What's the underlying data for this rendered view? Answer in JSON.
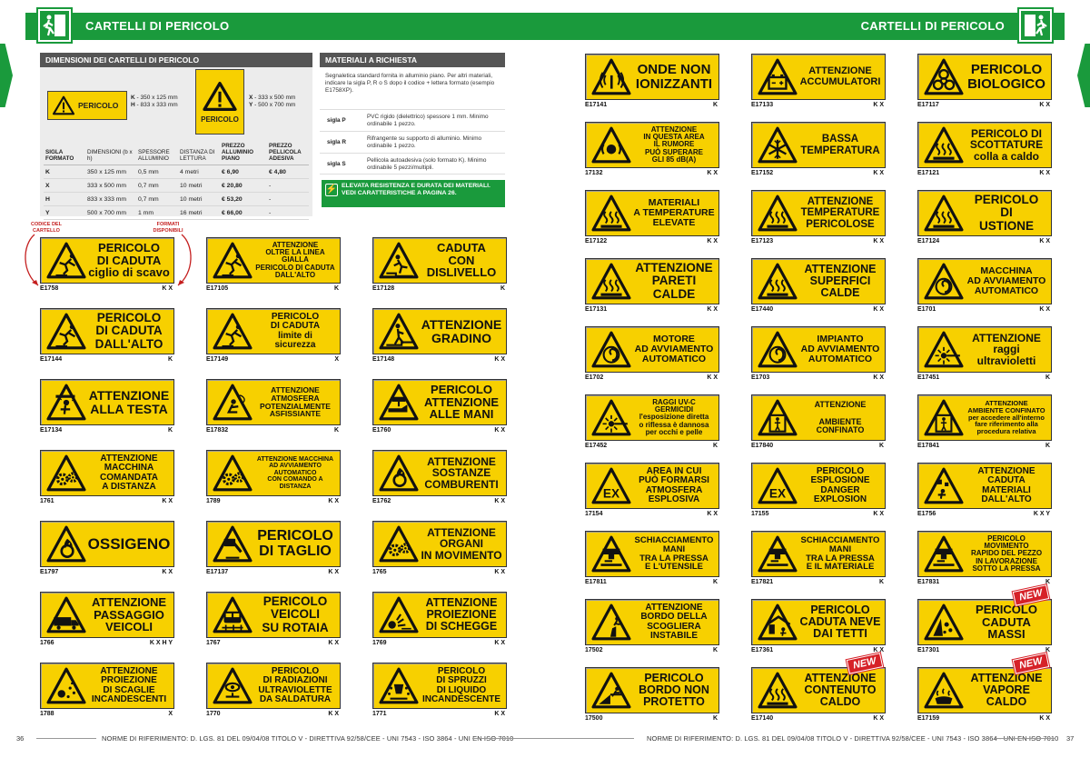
{
  "header": {
    "left_title": "CARTELLI DI PERICOLO",
    "right_title": "CARTELLI DI PERICOLO"
  },
  "dimensions_panel": {
    "title": "DIMENSIONI DEI CARTELLI DI PERICOLO",
    "sample_k_text": "PERICOLO",
    "sample_x_text": "PERICOLO",
    "k_label": "K",
    "k_value": " - 350 x 125 mm",
    "h_label": "H",
    "h_value": " - 833 x 333 mm",
    "x_label": "X",
    "x_value": " - 333 x 500 mm",
    "y_label": "Y",
    "y_value": " - 500 x 700 mm",
    "columns": [
      "SIGLA FORMATO",
      "DIMENSIONI (b x h)",
      "SPESSORE ALLUMINIO",
      "DISTANZA DI LETTURA",
      "PREZZO ALLUMINIO PIANO",
      "PREZZO PELLICOLA ADESIVA"
    ],
    "rows": [
      [
        "K",
        "350 x 125 mm",
        "0,5 mm",
        "4 metri",
        "€ 6,90",
        "€ 4,80"
      ],
      [
        "X",
        "333 x 500 mm",
        "0,7 mm",
        "10 metri",
        "€ 20,80",
        "-"
      ],
      [
        "H",
        "833 x 333 mm",
        "0,7 mm",
        "10 metri",
        "€ 53,20",
        "-"
      ],
      [
        "Y",
        "500 x 700 mm",
        "1 mm",
        "16 metri",
        "€ 66,00",
        "-"
      ]
    ]
  },
  "materials_panel": {
    "title": "MATERIALI A RICHIESTA",
    "description": "Segnaletica standard fornita in alluminio piano. Per altri materiali, indicare la sigla P, R o S dopo il codice + lettera formato (esempio E1758XP).",
    "items": [
      {
        "key": "sigla P",
        "value": "PVC rigido (dielettrico) spessore 1 mm. Minimo ordinabile 1 pezzo."
      },
      {
        "key": "sigla R",
        "value": "Rifrangente su supporto di alluminio. Minimo ordinabile 1 pezzo."
      },
      {
        "key": "sigla S",
        "value": "Pellicola autoadesiva (solo formato K). Minimo ordinabile 5 pezzi/multipli."
      }
    ],
    "note": "ELEVATA RESISTENZA E DURATA DEI MATERIALI. VEDI CARATTERISTICHE A PAGINA 26."
  },
  "annotations": {
    "code_label": "CODICE DEL CARTELLO",
    "formats_label": "FORMATI DISPONIBILI"
  },
  "signs": [
    {
      "code": "E1758",
      "formats": "K X",
      "text": "PERICOLO\nDI CADUTA\nciglio di scavo",
      "icon": "falling-person-icon",
      "size": 13,
      "new": false
    },
    {
      "code": "E17105",
      "formats": "K",
      "text": "ATTENZIONE\nOLTRE LA LINEA GIALLA\nPERICOLO DI CADUTA\nDALL'ALTO",
      "icon": "falling-person-icon",
      "size": 8,
      "new": false
    },
    {
      "code": "E17128",
      "formats": "K",
      "text": "CADUTA\nCON\nDISLIVELLO",
      "icon": "step-fall-icon",
      "size": 13,
      "new": false
    },
    {
      "code": "E17144",
      "formats": "K",
      "text": "PERICOLO\nDI CADUTA\nDALL'ALTO",
      "icon": "falling-person-icon",
      "size": 14,
      "new": false
    },
    {
      "code": "E17149",
      "formats": "X",
      "text": "PERICOLO\nDI CADUTA\nlimite di\nsicurezza",
      "icon": "falling-person-icon",
      "size": 12,
      "new": false
    },
    {
      "code": "E17148",
      "formats": "K X",
      "text": "ATTENZIONE\nGRADINO",
      "icon": "step-icon",
      "size": 15,
      "new": false
    },
    {
      "code": "E17134",
      "formats": "K",
      "text": "ATTENZIONE\nALLA TESTA",
      "icon": "head-bump-icon",
      "size": 15,
      "new": false
    },
    {
      "code": "E17832",
      "formats": "K",
      "text": "ATTENZIONE\nATMOSFERA POTENZIALMENTE\nASFISSIANTE",
      "icon": "asphyxia-icon",
      "size": 8.5,
      "new": false
    },
    {
      "code": "E1760",
      "formats": "K X",
      "text": "PERICOLO\nATTENZIONE\nALLE MANI",
      "icon": "hand-crush-icon",
      "size": 13,
      "new": false
    },
    {
      "code": "1761",
      "formats": "K X",
      "text": "ATTENZIONE\nMACCHINA\nCOMANDATA\nA DISTANZA",
      "icon": "gears-icon",
      "size": 11,
      "new": false
    },
    {
      "code": "1789",
      "formats": "K X",
      "text": "ATTENZIONE MACCHINA\nAD AVVIAMENTO AUTOMATICO\nCON COMANDO A DISTANZA",
      "icon": "gears-icon",
      "size": 8,
      "new": false
    },
    {
      "code": "E1762",
      "formats": "K X",
      "text": "ATTENZIONE\nSOSTANZE\nCOMBURENTI",
      "icon": "oxidizer-icon",
      "size": 12,
      "new": false
    },
    {
      "code": "E1797",
      "formats": "K X",
      "text": "OSSIGENO",
      "icon": "oxidizer-icon",
      "size": 20,
      "new": false
    },
    {
      "code": "E17137",
      "formats": "K X",
      "text": "PERICOLO\nDI TAGLIO",
      "icon": "cut-icon",
      "size": 16,
      "new": false
    },
    {
      "code": "1765",
      "formats": "K X",
      "text": "ATTENZIONE\nORGANI\nIN MOVIMENTO",
      "icon": "gears-icon",
      "size": 12,
      "new": false
    },
    {
      "code": "1766",
      "formats": "K X H Y",
      "text": "ATTENZIONE\nPASSAGGIO\nVEICOLI",
      "icon": "truck-icon",
      "size": 13,
      "new": false
    },
    {
      "code": "1767",
      "formats": "K X",
      "text": "PERICOLO\nVEICOLI\nSU ROTAIA",
      "icon": "rail-icon",
      "size": 14,
      "new": false
    },
    {
      "code": "1769",
      "formats": "K X",
      "text": "ATTENZIONE\nPROIEZIONE\nDI SCHEGGE",
      "icon": "splinter-icon",
      "size": 12.5,
      "new": false
    },
    {
      "code": "1788",
      "formats": "X",
      "text": "ATTENZIONE\nPROIEZIONE\nDI SCAGLIE\nINCANDESCENTI",
      "icon": "sparks-icon",
      "size": 10,
      "new": false
    },
    {
      "code": "1770",
      "formats": "K X",
      "text": "PERICOLO\nDI RADIAZIONI\nULTRAVIOLETTE\nDA SALDATURA",
      "icon": "welding-icon",
      "size": 10,
      "new": false
    },
    {
      "code": "1771",
      "formats": "K X",
      "text": "PERICOLO\nDI SPRUZZI\nDI LIQUIDO\nINCANDESCENTE",
      "icon": "splash-icon",
      "size": 10,
      "new": false
    },
    {
      "code": "E17141",
      "formats": "K",
      "text": "ONDE NON\nIONIZZANTI",
      "icon": "radio-waves-icon",
      "size": 15,
      "new": false
    },
    {
      "code": "E17133",
      "formats": "K X",
      "text": "ATTENZIONE\nACCUMULATORI",
      "icon": "battery-icon",
      "size": 11.5,
      "new": false
    },
    {
      "code": "E17117",
      "formats": "K X",
      "text": "PERICOLO\nBIOLOGICO",
      "icon": "biohazard-icon",
      "size": 15,
      "new": false
    },
    {
      "code": "17132",
      "formats": "K X",
      "text": "ATTENZIONE\nIN QUESTA AREA\nIL RUMORE\nPUÒ SUPERARE\nGLI 85 dB(A)",
      "icon": "noise-icon",
      "size": 8.5,
      "new": false
    },
    {
      "code": "E17152",
      "formats": "K X",
      "text": "BASSA\nTEMPERATURA",
      "icon": "snowflake-icon",
      "size": 15,
      "new": false
    },
    {
      "code": "E17121",
      "formats": "K X",
      "text": "PERICOLO DI\nSCOTTATURE\ncolla a caldo",
      "icon": "hot-surface-icon",
      "size": 12,
      "new": false
    },
    {
      "code": "E17122",
      "formats": "K X",
      "text": "MATERIALI\nA TEMPERATURE\nELEVATE",
      "icon": "hot-surface-icon",
      "size": 11.5,
      "new": false
    },
    {
      "code": "E17123",
      "formats": "K X",
      "text": "ATTENZIONE\nTEMPERATURE\nPERICOLOSE",
      "icon": "hot-surface-icon",
      "size": 11.5,
      "new": false
    },
    {
      "code": "E17124",
      "formats": "K X",
      "text": "PERICOLO\nDI\nUSTIONE",
      "icon": "hot-surface-icon",
      "size": 14,
      "new": false
    },
    {
      "code": "E17131",
      "formats": "K X",
      "text": "ATTENZIONE\nPARETI CALDE",
      "icon": "hot-surface-icon",
      "size": 14,
      "new": false
    },
    {
      "code": "E17440",
      "formats": "K X",
      "text": "ATTENZIONE\nSUPERFICI\nCALDE",
      "icon": "hot-surface-icon",
      "size": 12.5,
      "new": false
    },
    {
      "code": "E1701",
      "formats": "K X",
      "text": "MACCHINA\nAD AVVIAMENTO\nAUTOMATICO",
      "icon": "auto-start-icon",
      "size": 11,
      "new": false
    },
    {
      "code": "E1702",
      "formats": "K X",
      "text": "MOTORE\nAD AVVIAMENTO\nAUTOMATICO",
      "icon": "auto-start-icon",
      "size": 11,
      "new": false
    },
    {
      "code": "E1703",
      "formats": "K X",
      "text": "IMPIANTO\nAD AVVIAMENTO\nAUTOMATICO",
      "icon": "auto-start-icon",
      "size": 11,
      "new": false
    },
    {
      "code": "E17451",
      "formats": "K",
      "text": "ATTENZIONE\nraggi\nultravioletti",
      "icon": "laser-icon",
      "size": 12,
      "new": false
    },
    {
      "code": "E17452",
      "formats": "K",
      "text": "RAGGI UV-C GERMICIDI\nl'esposizione diretta\no riflessa è dannosa\nper occhi e pelle",
      "icon": "laser-icon",
      "size": 8,
      "new": false
    },
    {
      "code": "E17840",
      "formats": "K",
      "text": "ATTENZIONE\n\nAMBIENTE CONFINATO",
      "icon": "confined-space-icon",
      "size": 9,
      "new": false
    },
    {
      "code": "E17841",
      "formats": "K",
      "text": "ATTENZIONE\nAMBIENTE CONFINATO\nper accedere all'interno\nfare riferimento alla\nprocedura relativa",
      "icon": "confined-space-icon",
      "size": 7.5,
      "new": false
    },
    {
      "code": "17154",
      "formats": "K X",
      "text": "AREA IN CUI\nPUÒ FORMARSI\nATMOSFERA\nESPLOSIVA",
      "icon": "ex-icon",
      "size": 10.5,
      "new": false
    },
    {
      "code": "17155",
      "formats": "K X",
      "text": "PERICOLO\nESPLOSIONE\nDANGER\nEXPLOSION",
      "icon": "ex-icon",
      "size": 10.5,
      "new": false
    },
    {
      "code": "E1756",
      "formats": "K X Y",
      "text": "ATTENZIONE\nCADUTA\nMATERIALI\nDALL'ALTO",
      "icon": "falling-objects-icon",
      "size": 11,
      "new": false
    },
    {
      "code": "E17811",
      "formats": "K",
      "text": "SCHIACCIAMENTO MANI\nTRA LA PRESSA\nE L'UTENSILE",
      "icon": "press-icon",
      "size": 9.5,
      "new": false
    },
    {
      "code": "E17821",
      "formats": "K",
      "text": "SCHIACCIAMENTO MANI\nTRA LA PRESSA\nE IL MATERIALE",
      "icon": "press-icon",
      "size": 9.5,
      "new": false
    },
    {
      "code": "E17831",
      "formats": "K",
      "text": "PERICOLO MOVIMENTO\nRAPIDO DEL PEZZO\nIN LAVORAZIONE\nSOTTO LA PRESSA",
      "icon": "press-icon",
      "size": 8,
      "new": false
    },
    {
      "code": "17502",
      "formats": "K",
      "text": "ATTENZIONE\nBORDO DELLA\nSCOGLIERA\nINSTABILE",
      "icon": "cliff-icon",
      "size": 10,
      "new": false
    },
    {
      "code": "E17361",
      "formats": "K X",
      "text": "PERICOLO\nCADUTA NEVE\nDAI TETTI",
      "icon": "roof-snow-icon",
      "size": 12.5,
      "new": false
    },
    {
      "code": "E17301",
      "formats": "K",
      "text": "PERICOLO\nCADUTA\nMASSI",
      "icon": "rockfall-icon",
      "size": 13,
      "new": true
    },
    {
      "code": "17500",
      "formats": "K",
      "text": "PERICOLO\nBORDO NON\nPROTETTO",
      "icon": "edge-fall-icon",
      "size": 12.5,
      "new": false
    },
    {
      "code": "E17140",
      "formats": "K X",
      "text": "ATTENZIONE\nCONTENUTO\nCALDO",
      "icon": "hot-surface-icon",
      "size": 12.5,
      "new": true
    },
    {
      "code": "E17159",
      "formats": "K X",
      "text": "ATTENZIONE\nVAPORE\nCALDO",
      "icon": "steam-icon",
      "size": 12.5,
      "new": true
    }
  ],
  "new_label": "NEW",
  "footer": {
    "left_page": "36",
    "right_page": "37",
    "left_text": "NORME DI RIFERIMENTO: D. LGS. 81 DEL 09/04/08 TITOLO V - DIRETTIVA 92/58/CEE - UNI 7543 - ISO 3864 - UNI EN ISO 7010",
    "right_text": "NORME DI RIFERIMENTO: D. LGS. 81 DEL 09/04/08 TITOLO V - DIRETTIVA 92/58/CEE - UNI 7543 - ISO 3864 - UNI EN ISO 7010"
  },
  "colors": {
    "brand_green": "#1a9a3c",
    "sign_yellow": "#f7d000",
    "new_red": "#d62128"
  }
}
